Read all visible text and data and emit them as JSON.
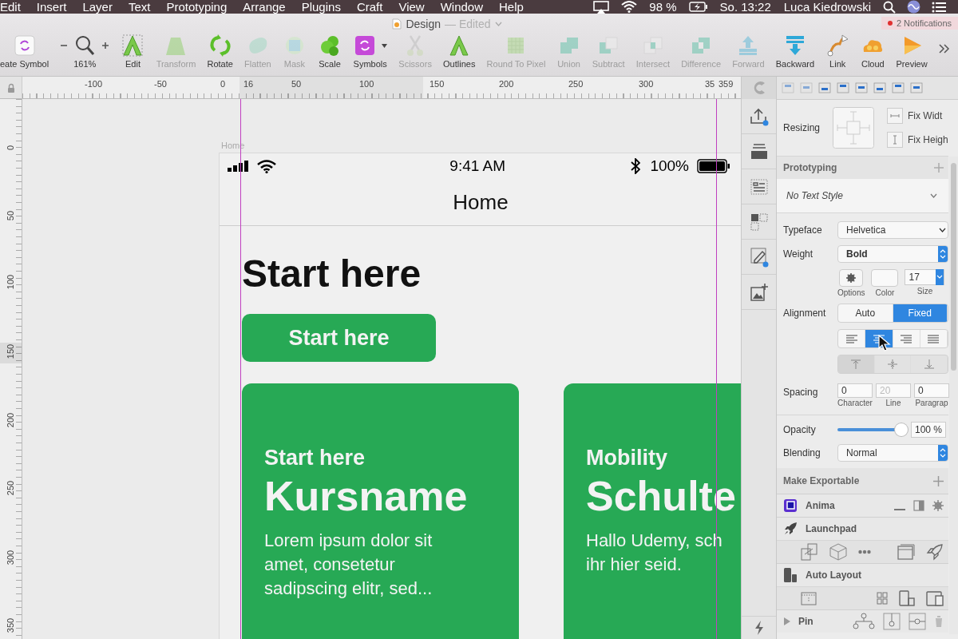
{
  "menu_bar": {
    "items": [
      "Edit",
      "Insert",
      "Layer",
      "Text",
      "Prototyping",
      "Arrange",
      "Plugins",
      "Craft",
      "View",
      "Window",
      "Help"
    ],
    "battery": "98 %",
    "clock": "So. 13:22",
    "user": "Luca Kiedrowski"
  },
  "toolbar": {
    "document_title": "Design",
    "document_status": "— Edited",
    "notifications": "2 Notifications",
    "tools": [
      {
        "kind": "symbol",
        "label": "eate Symbol",
        "disabled": false
      },
      {
        "kind": "zoom",
        "label": "161%",
        "disabled": false
      },
      {
        "kind": "edit",
        "label": "Edit",
        "disabled": false
      },
      {
        "kind": "transform",
        "label": "Transform",
        "disabled": true
      },
      {
        "kind": "rotate",
        "label": "Rotate",
        "disabled": false
      },
      {
        "kind": "flatten",
        "label": "Flatten",
        "disabled": true
      },
      {
        "kind": "mask",
        "label": "Mask",
        "disabled": true
      },
      {
        "kind": "scale",
        "label": "Scale",
        "disabled": false
      },
      {
        "kind": "symbols",
        "label": "Symbols",
        "disabled": false
      },
      {
        "kind": "scissors",
        "label": "Scissors",
        "disabled": true
      },
      {
        "kind": "outlines",
        "label": "Outlines",
        "disabled": false
      },
      {
        "kind": "pixel",
        "label": "Round To Pixel",
        "disabled": true
      },
      {
        "kind": "union",
        "label": "Union",
        "disabled": true
      },
      {
        "kind": "subtract",
        "label": "Subtract",
        "disabled": true
      },
      {
        "kind": "intersect",
        "label": "Intersect",
        "disabled": true
      },
      {
        "kind": "difference",
        "label": "Difference",
        "disabled": true
      },
      {
        "kind": "forward",
        "label": "Forward",
        "disabled": true
      },
      {
        "kind": "backward",
        "label": "Backward",
        "disabled": false
      },
      {
        "kind": "link",
        "label": "Link",
        "disabled": false
      },
      {
        "kind": "cloud",
        "label": "Cloud",
        "disabled": false
      },
      {
        "kind": "preview",
        "label": "Preview",
        "disabled": false
      }
    ]
  },
  "rulers": {
    "horizontal": [
      "-100",
      "-50",
      "0",
      "16",
      "50",
      "100",
      "150",
      "200",
      "250",
      "300",
      "35",
      "359"
    ],
    "vertical": [
      "0",
      "50",
      "100",
      "150",
      "200",
      "250",
      "300",
      "350"
    ]
  },
  "artboard": {
    "name": "Home",
    "time": "9:41 AM",
    "battery": "100%",
    "nav_title": "Home",
    "heading": "Start here",
    "button": "Start here",
    "cards": [
      {
        "eyebrow": "Start here",
        "title": "Kursname",
        "body_lines": [
          "Lorem ipsum dolor sit",
          "amet, consetetur",
          "sadipscing elitr, sed..."
        ]
      },
      {
        "eyebrow": "Mobility",
        "title": "Schulte",
        "body_lines": [
          "Hallo Udemy, sch",
          "ihr hier seid."
        ]
      }
    ]
  },
  "inspector": {
    "resizing": {
      "label": "Resizing",
      "options": [
        "Fix Widt",
        "Fix Heigh"
      ]
    },
    "prototyping": "Prototyping",
    "text_style": "No Text Style",
    "typeface": {
      "label": "Typeface",
      "value": "Helvetica"
    },
    "weight": {
      "label": "Weight",
      "value": "Bold"
    },
    "font_controls": {
      "options_label": "Options",
      "color_label": "Color",
      "size": "17",
      "size_label": "Size"
    },
    "alignment": {
      "label": "Alignment",
      "modes": [
        {
          "label": "Auto",
          "selected": false
        },
        {
          "label": "Fixed",
          "selected": true
        }
      ],
      "text_align": [
        {
          "kind": "left",
          "selected": false
        },
        {
          "kind": "center",
          "selected": true
        },
        {
          "kind": "right",
          "selected": false
        },
        {
          "kind": "justify",
          "selected": false
        }
      ],
      "vertical_align": [
        {
          "kind": "top",
          "selected": true
        },
        {
          "kind": "middle",
          "selected": false
        },
        {
          "kind": "bottom",
          "selected": false
        }
      ]
    },
    "spacing": {
      "label": "Spacing",
      "fields": [
        {
          "value": "0",
          "label": "Character"
        },
        {
          "placeholder": "20",
          "label": "Line"
        },
        {
          "value": "0",
          "label": "Paragrap"
        }
      ]
    },
    "opacity": {
      "label": "Opacity",
      "level": 1,
      "reading": "100 %"
    },
    "blending": {
      "label": "Blending",
      "value": "Normal"
    },
    "exportable": "Make Exportable",
    "plugins": [
      {
        "kind": "anima",
        "name": "Anima"
      },
      {
        "kind": "launchpad",
        "name": "Launchpad"
      },
      {
        "kind": "autolayout",
        "name": "Auto Layout"
      },
      {
        "kind": "pin",
        "name": "Pin"
      }
    ]
  }
}
